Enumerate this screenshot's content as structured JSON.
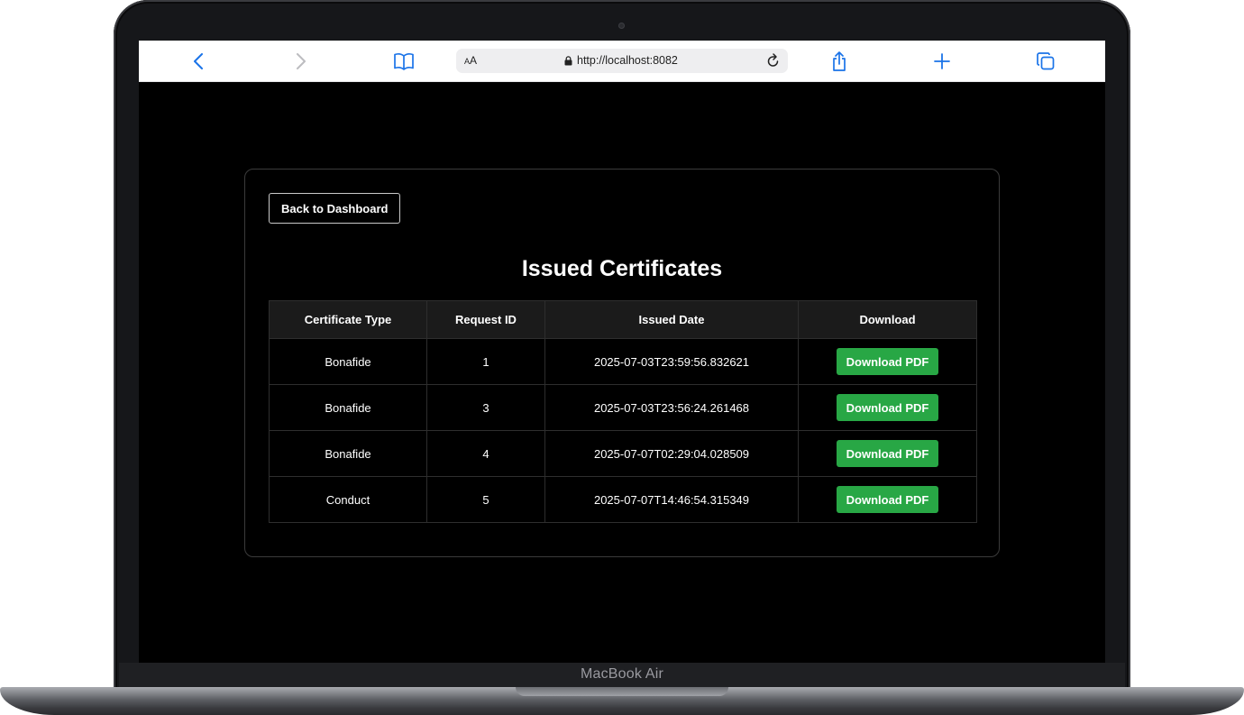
{
  "device": {
    "label": "MacBook Air"
  },
  "browser": {
    "text_size_label": "AA",
    "url": "http://localhost:8082",
    "accent_color": "#1a73e8"
  },
  "page": {
    "back_label": "Back to Dashboard",
    "title": "Issued Certificates",
    "columns": [
      "Certificate Type",
      "Request ID",
      "Issued Date",
      "Download"
    ],
    "rows": [
      {
        "type": "Bonafide",
        "id": "1",
        "date": "2025-07-03T23:59:56.832621",
        "action": "Download PDF"
      },
      {
        "type": "Bonafide",
        "id": "3",
        "date": "2025-07-03T23:56:24.261468",
        "action": "Download PDF"
      },
      {
        "type": "Bonafide",
        "id": "4",
        "date": "2025-07-07T02:29:04.028509",
        "action": "Download PDF"
      },
      {
        "type": "Conduct",
        "id": "5",
        "date": "2025-07-07T14:46:54.315349",
        "action": "Download PDF"
      }
    ],
    "button_color": "#28a745"
  }
}
